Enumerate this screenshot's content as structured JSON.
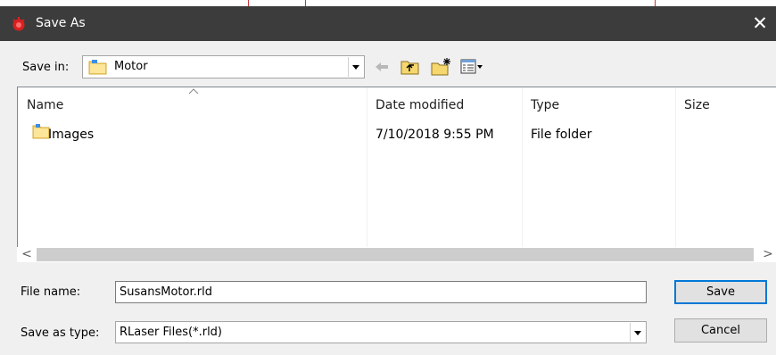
{
  "window": {
    "title": "Save As",
    "close_glyph": "✕"
  },
  "toolbar": {
    "save_in_label": "Save in:",
    "save_in_value": "Motor",
    "back_icon": "back-arrow-icon",
    "up_icon": "up-folder-icon",
    "new_folder_icon": "new-folder-icon",
    "view_menu_icon": "view-menu-icon"
  },
  "file_list": {
    "columns": [
      {
        "label": "Name"
      },
      {
        "label": "Date modified"
      },
      {
        "label": "Type"
      },
      {
        "label": "Size"
      }
    ],
    "rows": [
      {
        "name": "Images",
        "date_modified": "7/10/2018 9:55 PM",
        "type": "File folder",
        "size": ""
      }
    ]
  },
  "scrollbar": {
    "left_glyph": "<",
    "right_glyph": ">"
  },
  "file_name": {
    "label": "File name:",
    "value": "SusansMotor.rld"
  },
  "save_as_type": {
    "label": "Save as type:",
    "value": "RLaser Files(*.rld)"
  },
  "buttons": {
    "save": "Save",
    "cancel": "Cancel"
  },
  "colors": {
    "titlebar": "#3c3c3c",
    "accent": "#0078d7",
    "folder": "#f5d76e"
  }
}
